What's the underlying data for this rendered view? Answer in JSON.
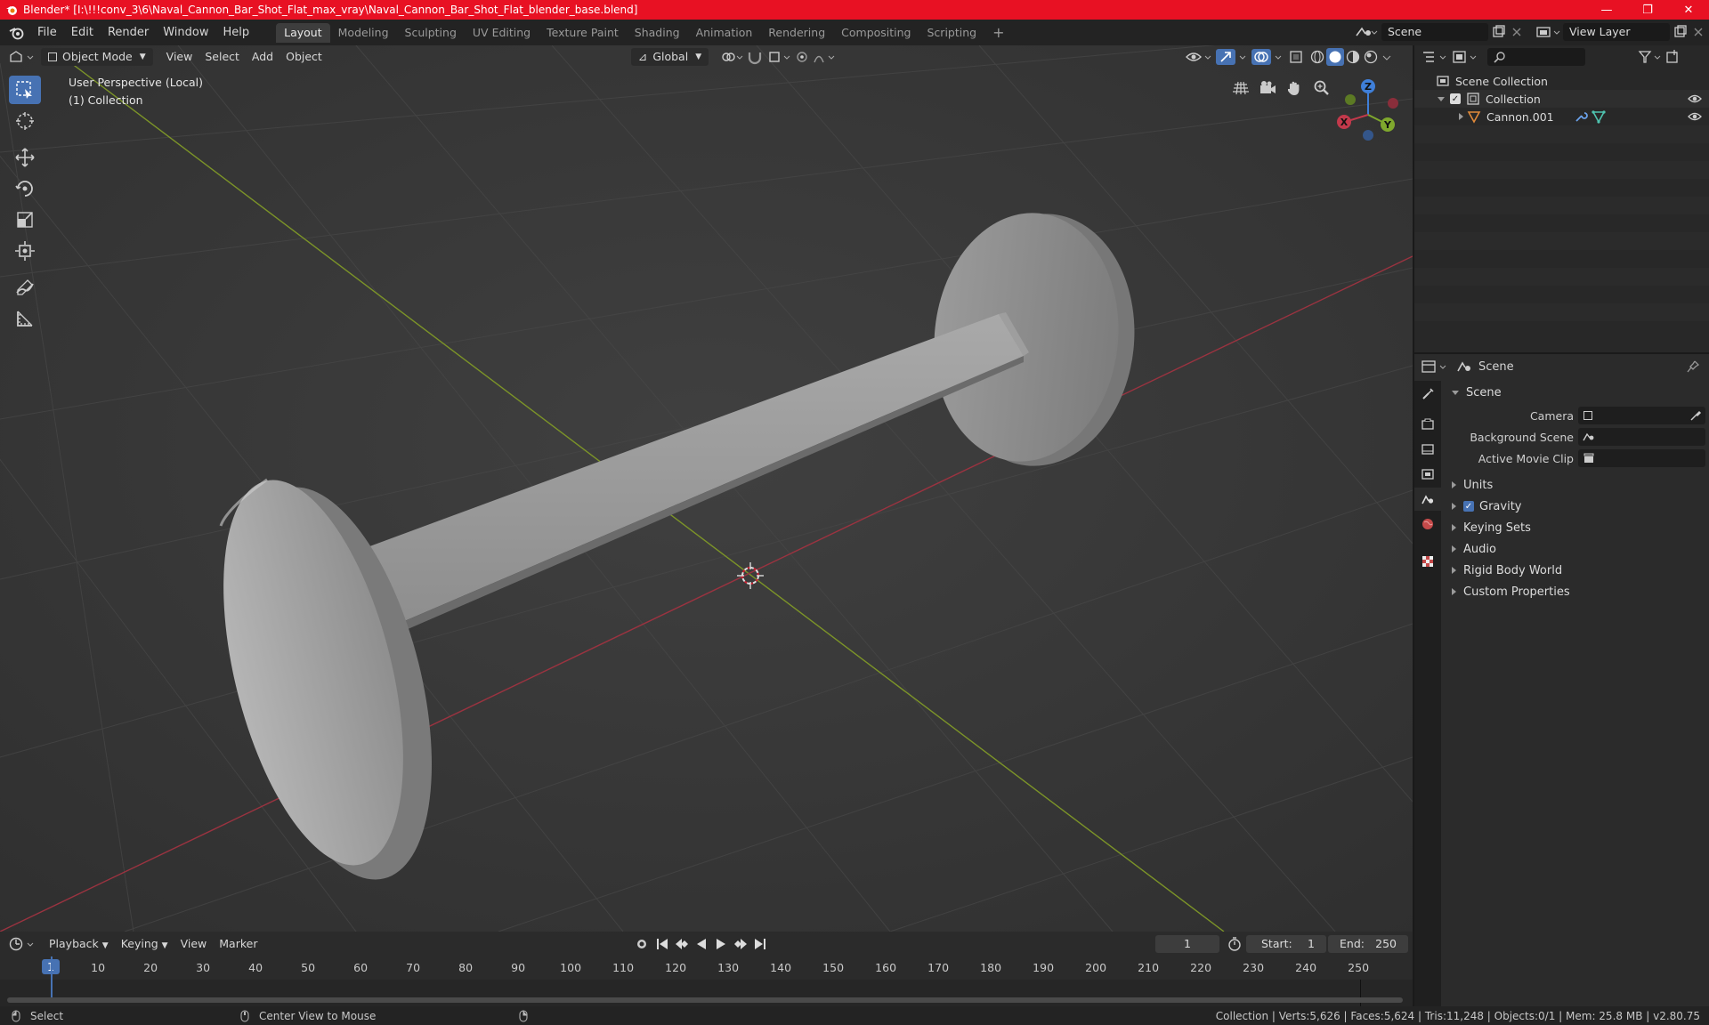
{
  "window": {
    "title": "Blender* [I:\\!!!conv_3\\6\\Naval_Cannon_Bar_Shot_Flat_max_vray\\Naval_Cannon_Bar_Shot_Flat_blender_base.blend]",
    "buttons": [
      "—",
      "❐",
      "✕"
    ]
  },
  "menu": [
    "File",
    "Edit",
    "Render",
    "Window",
    "Help"
  ],
  "workspaces": [
    "Layout",
    "Modeling",
    "Sculpting",
    "UV Editing",
    "Texture Paint",
    "Shading",
    "Animation",
    "Rendering",
    "Compositing",
    "Scripting"
  ],
  "active_workspace": "Layout",
  "topright": {
    "scene": "Scene",
    "view_layer": "View Layer"
  },
  "viewport": {
    "mode": "Object Mode",
    "menus": [
      "View",
      "Select",
      "Add",
      "Object"
    ],
    "orientation": "Global",
    "perspective": "User Perspective (Local)",
    "collection": "(1) Collection",
    "gizmo": {
      "x": "X",
      "y": "Y",
      "z": "Z"
    }
  },
  "timeline": {
    "menus": [
      "Playback",
      "Keying",
      "View",
      "Marker"
    ],
    "current_frame": "1",
    "start_label": "Start:",
    "start": "1",
    "end_label": "End:",
    "end": "250",
    "ticks": [
      "1",
      "10",
      "20",
      "30",
      "40",
      "50",
      "60",
      "70",
      "80",
      "90",
      "100",
      "110",
      "120",
      "130",
      "140",
      "150",
      "160",
      "170",
      "180",
      "190",
      "200",
      "210",
      "220",
      "230",
      "240",
      "250"
    ]
  },
  "status": {
    "select": "Select",
    "center": "Center View to Mouse",
    "stats": "Collection | Verts:5,626 | Faces:5,624 | Tris:11,248 | Objects:0/1 | Mem: 25.8 MB | v2.80.75"
  },
  "outliner": {
    "root": "Scene Collection",
    "collection": "Collection",
    "object": "Cannon.001"
  },
  "properties": {
    "header": "Scene",
    "panel": "Scene",
    "fields": {
      "camera": "Camera",
      "background_scene": "Background Scene",
      "active_movie_clip": "Active Movie Clip"
    },
    "panels": [
      "Units",
      "Gravity",
      "Keying Sets",
      "Audio",
      "Rigid Body World",
      "Custom Properties"
    ]
  },
  "colors": {
    "accent": "#4772b3",
    "title_bar": "#e81123",
    "x_axis": "#c2394b",
    "y_axis": "#7fa82d",
    "z_axis": "#3f7fd9"
  }
}
